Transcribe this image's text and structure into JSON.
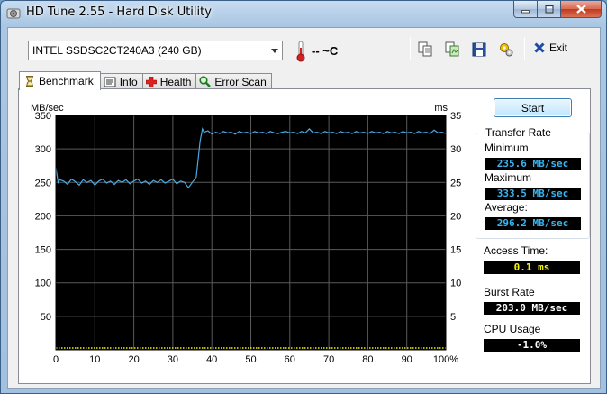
{
  "window": {
    "title": "HD Tune 2.55 - Hard Disk Utility"
  },
  "toolbar": {
    "drive": "INTEL SSDSC2CT240A3 (240 GB)",
    "temperature": "-- ~C",
    "exit_label": "Exit"
  },
  "tabs": [
    {
      "label": "Benchmark",
      "active": true
    },
    {
      "label": "Info",
      "active": false
    },
    {
      "label": "Health",
      "active": false
    },
    {
      "label": "Error Scan",
      "active": false
    }
  ],
  "benchmark": {
    "start_label": "Start",
    "transfer_rate": {
      "title": "Transfer Rate",
      "minimum_label": "Minimum",
      "minimum": "235.6 MB/sec",
      "maximum_label": "Maximum",
      "maximum": "333.5 MB/sec",
      "average_label": "Average:",
      "average": "296.2 MB/sec"
    },
    "access_time_label": "Access Time:",
    "access_time": "0.1 ms",
    "burst_rate_label": "Burst Rate",
    "burst_rate": "203.0 MB/sec",
    "cpu_usage_label": "CPU Usage",
    "cpu_usage": "-1.0%"
  },
  "colors": {
    "plot_bg": "#000000",
    "transfer_line": "#4aa8e4",
    "access_dots": "#f4f000",
    "grid": "#5a5a5a"
  },
  "chart_data": {
    "type": "line",
    "ylabel_left": "MB/sec",
    "ylabel_right": "ms",
    "ylim_left": [
      0,
      350
    ],
    "ylim_right": [
      0,
      35
    ],
    "xlim": [
      0,
      100
    ],
    "left_ticks": [
      "350",
      "300",
      "250",
      "200",
      "150",
      "100",
      "50"
    ],
    "right_ticks": [
      "35",
      "30",
      "25",
      "20",
      "15",
      "10",
      "5"
    ],
    "x_ticks": [
      "0",
      "10",
      "20",
      "30",
      "40",
      "50",
      "60",
      "70",
      "80",
      "90",
      "100%"
    ],
    "grid": true,
    "series": [
      {
        "values": [
          [
            0,
            272
          ],
          [
            0.6,
            250
          ],
          [
            1,
            254
          ],
          [
            2,
            252
          ],
          [
            3,
            247
          ],
          [
            4,
            255
          ],
          [
            5,
            251
          ],
          [
            6,
            246
          ],
          [
            7,
            254
          ],
          [
            8,
            250
          ],
          [
            9,
            253
          ],
          [
            10,
            246
          ],
          [
            11,
            252
          ],
          [
            12,
            255
          ],
          [
            13,
            249
          ],
          [
            14,
            252
          ],
          [
            15,
            247
          ],
          [
            16,
            253
          ],
          [
            17,
            250
          ],
          [
            18,
            254
          ],
          [
            19,
            248
          ],
          [
            20,
            252
          ],
          [
            21,
            255
          ],
          [
            22,
            249
          ],
          [
            23,
            252
          ],
          [
            24,
            247
          ],
          [
            25,
            253
          ],
          [
            26,
            250
          ],
          [
            27,
            254
          ],
          [
            28,
            249
          ],
          [
            29,
            252
          ],
          [
            30,
            255
          ],
          [
            31,
            248
          ],
          [
            32,
            252
          ],
          [
            33,
            250
          ],
          [
            34,
            242
          ],
          [
            35,
            250
          ],
          [
            36,
            258
          ],
          [
            37,
            312
          ],
          [
            37.6,
            330
          ],
          [
            38,
            325
          ],
          [
            39,
            327
          ],
          [
            40,
            322
          ],
          [
            41,
            325
          ],
          [
            42,
            323
          ],
          [
            43,
            326
          ],
          [
            44,
            324
          ],
          [
            45,
            325
          ],
          [
            46,
            322
          ],
          [
            47,
            326
          ],
          [
            48,
            324
          ],
          [
            49,
            325
          ],
          [
            50,
            323
          ],
          [
            51,
            326
          ],
          [
            52,
            324
          ],
          [
            53,
            325
          ],
          [
            54,
            323
          ],
          [
            55,
            326
          ],
          [
            56,
            324
          ],
          [
            57,
            323
          ],
          [
            58,
            325
          ],
          [
            59,
            326
          ],
          [
            60,
            324
          ],
          [
            61,
            325
          ],
          [
            62,
            323
          ],
          [
            63,
            326
          ],
          [
            64,
            324
          ],
          [
            65,
            330
          ],
          [
            66,
            324
          ],
          [
            67,
            325
          ],
          [
            68,
            323
          ],
          [
            69,
            326
          ],
          [
            70,
            324
          ],
          [
            71,
            325
          ],
          [
            72,
            323
          ],
          [
            73,
            326
          ],
          [
            74,
            324
          ],
          [
            75,
            325
          ],
          [
            76,
            323
          ],
          [
            77,
            326
          ],
          [
            78,
            324
          ],
          [
            79,
            325
          ],
          [
            80,
            323
          ],
          [
            81,
            326
          ],
          [
            82,
            324
          ],
          [
            83,
            325
          ],
          [
            84,
            323
          ],
          [
            85,
            326
          ],
          [
            86,
            324
          ],
          [
            87,
            325
          ],
          [
            88,
            323
          ],
          [
            89,
            326
          ],
          [
            90,
            324
          ],
          [
            91,
            325
          ],
          [
            92,
            323
          ],
          [
            93,
            326
          ],
          [
            94,
            324
          ],
          [
            95,
            325
          ],
          [
            96,
            323
          ],
          [
            97,
            328
          ],
          [
            98,
            324
          ],
          [
            99,
            325
          ],
          [
            100,
            323
          ]
        ]
      },
      {
        "values": [
          [
            0,
            0.1
          ],
          [
            50,
            0.1
          ],
          [
            100,
            0.1
          ]
        ]
      }
    ]
  }
}
